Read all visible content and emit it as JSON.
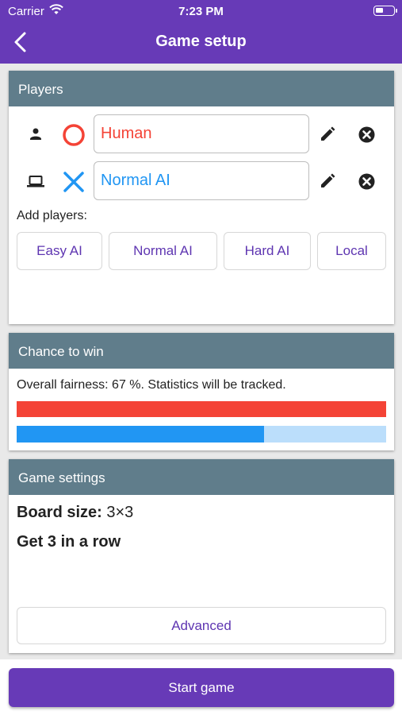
{
  "status_bar": {
    "carrier": "Carrier",
    "time": "7:23 PM"
  },
  "app_bar": {
    "title": "Game setup",
    "back_icon": "back-arrow-icon"
  },
  "colors": {
    "accent": "#673ab7",
    "header": "#607d8b",
    "player_o": "#f44336",
    "player_x": "#2196f3",
    "button_text": "#5e35b1"
  },
  "players": {
    "title": "Players",
    "list": [
      {
        "type_icon": "person-icon",
        "mark": "O",
        "mark_icon": "circle-mark-icon",
        "name": "Human",
        "color": "#f44336"
      },
      {
        "type_icon": "laptop-icon",
        "mark": "X",
        "mark_icon": "cross-mark-icon",
        "name": "Normal AI",
        "color": "#2196f3"
      }
    ],
    "add_label": "Add players:",
    "add_buttons": [
      "Easy AI",
      "Normal AI",
      "Hard AI",
      "Local"
    ]
  },
  "chance": {
    "title": "Chance to win",
    "fairness_text": "Overall fairness: 67 %. Statistics will be tracked.",
    "player1_share": 1.0,
    "player2_share": 0.67
  },
  "settings": {
    "title": "Game settings",
    "board_label": "Board size:",
    "board_value": "3×3",
    "win_rule": "Get 3 in a row",
    "advanced_label": "Advanced"
  },
  "start_label": "Start game"
}
